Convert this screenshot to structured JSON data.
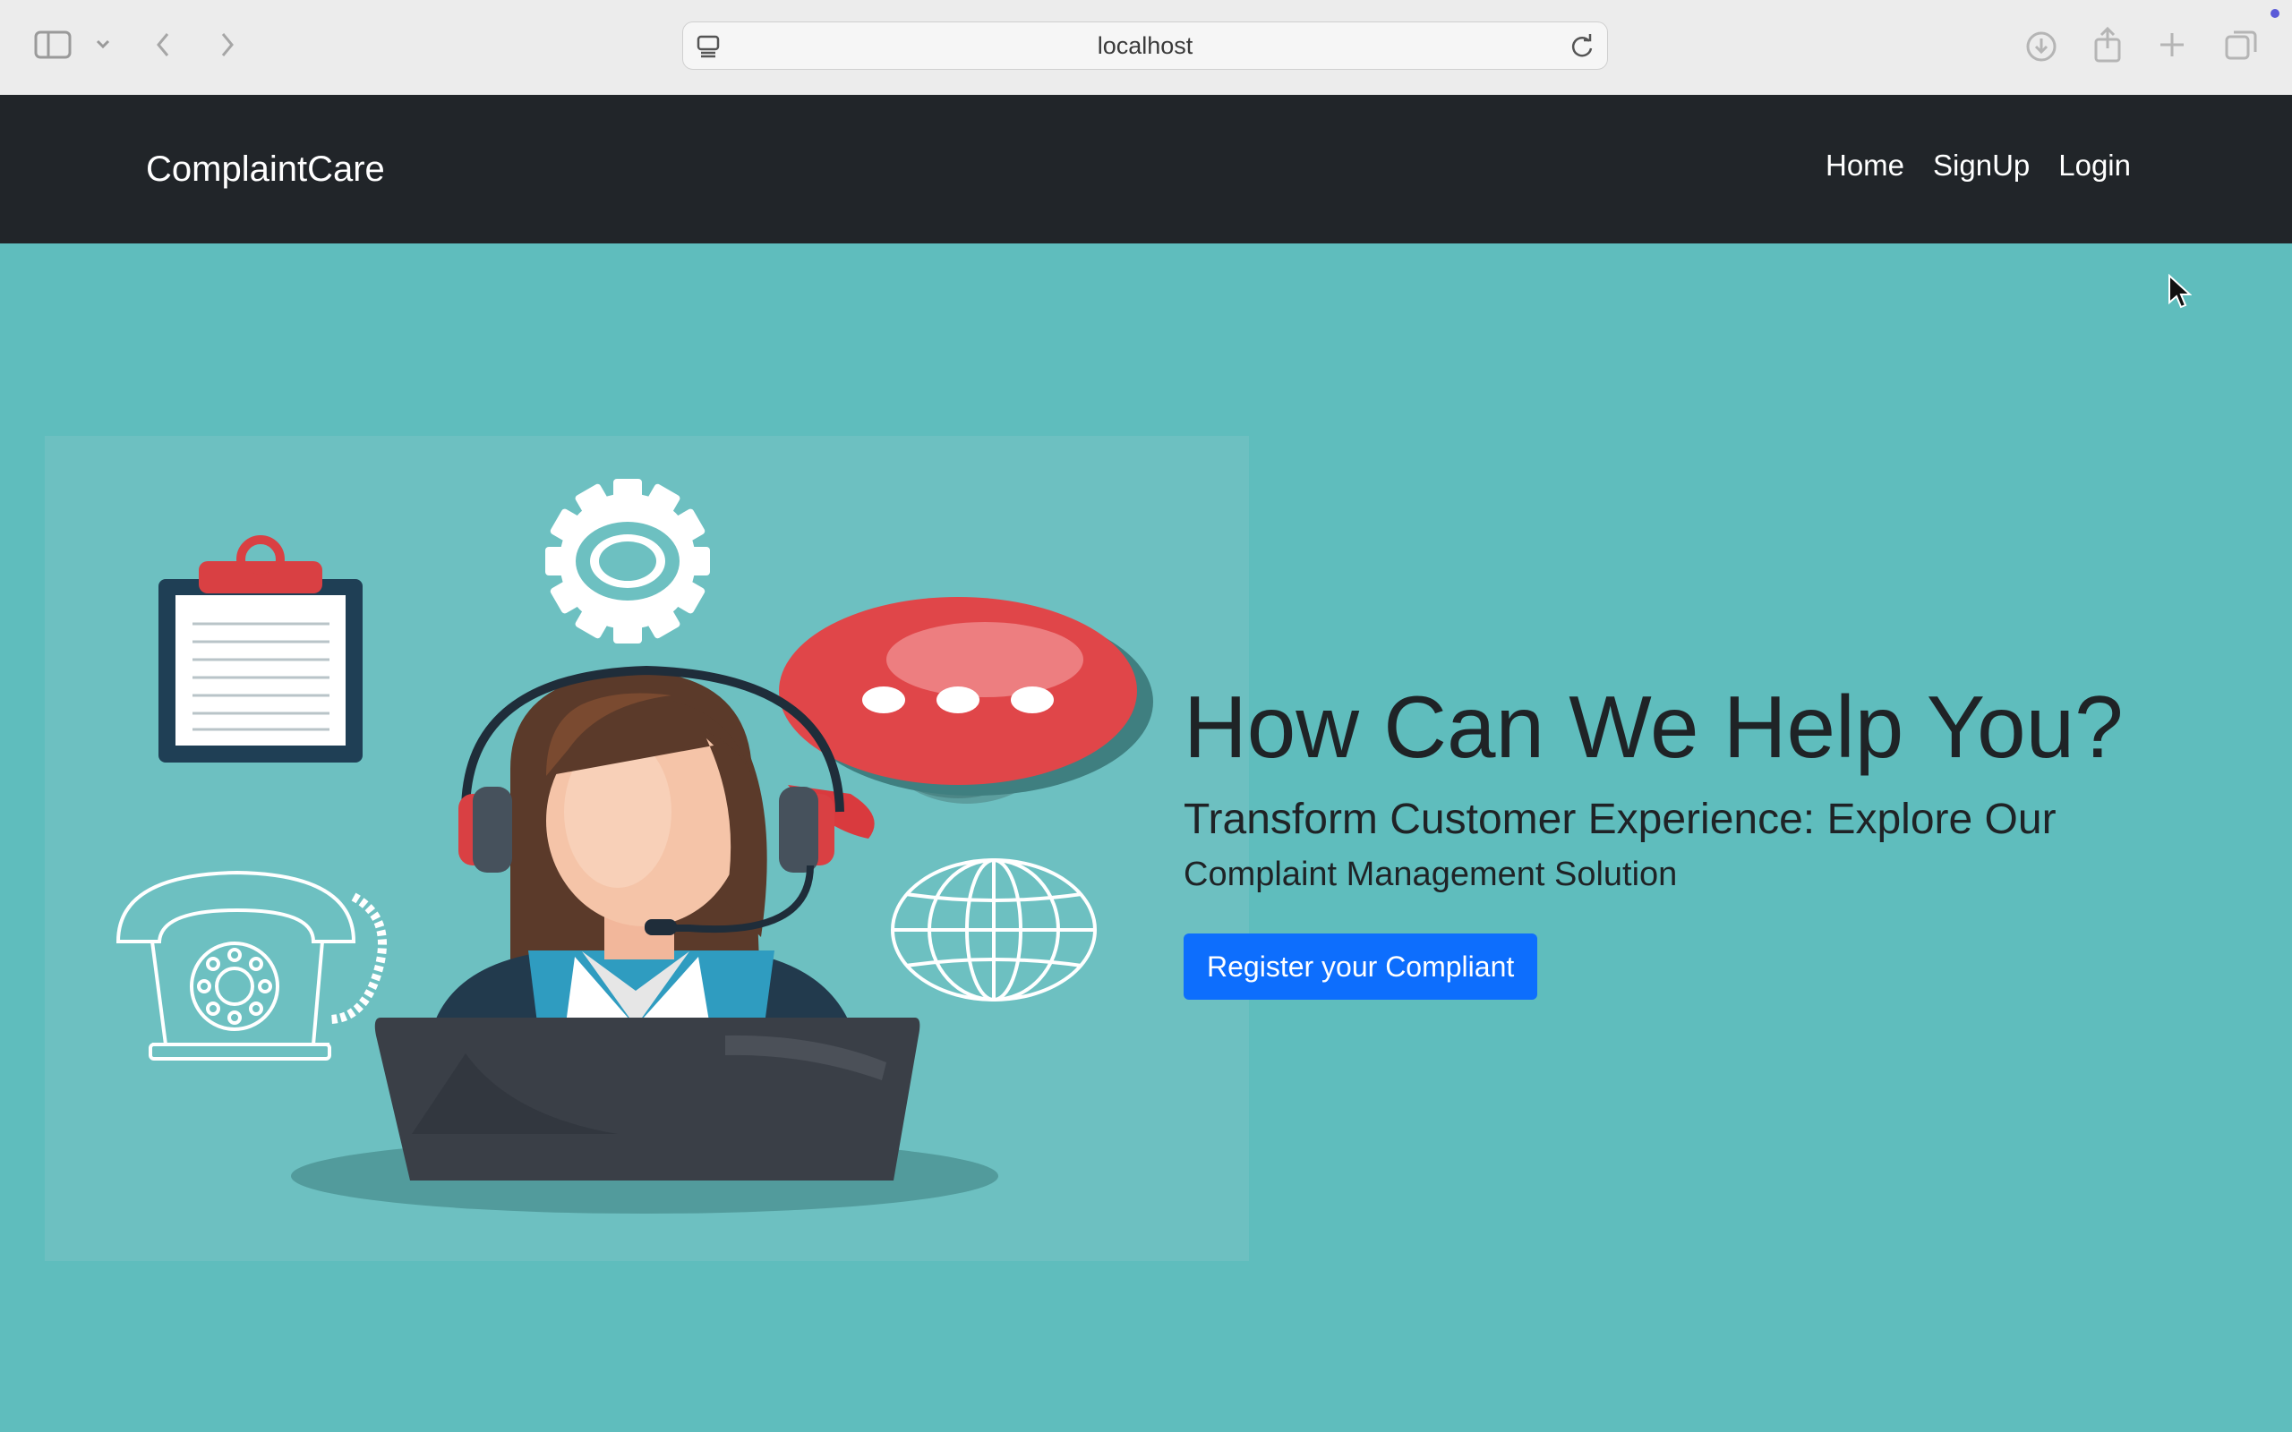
{
  "browser": {
    "url": "localhost",
    "icons": [
      "sidebar-toggle-icon",
      "chevron-down-icon",
      "back-icon",
      "forward-icon",
      "site-settings-icon",
      "reload-icon",
      "download-icon",
      "share-icon",
      "new-tab-icon",
      "tab-overview-icon"
    ]
  },
  "navbar": {
    "brand": "ComplaintCare",
    "links": [
      "Home",
      "SignUp",
      "Login"
    ]
  },
  "hero": {
    "title": "How Can We Help You?",
    "subtitle": "Transform Customer Experience: Explore Our",
    "subtitle_2": "Complaint Management Solution",
    "cta_label": "Register your Compliant"
  },
  "colors": {
    "navbar_bg": "#212529",
    "hero_bg": "#5fbdbd",
    "button_bg": "#0d6efd",
    "chat_bubble": "#d93a3e"
  }
}
